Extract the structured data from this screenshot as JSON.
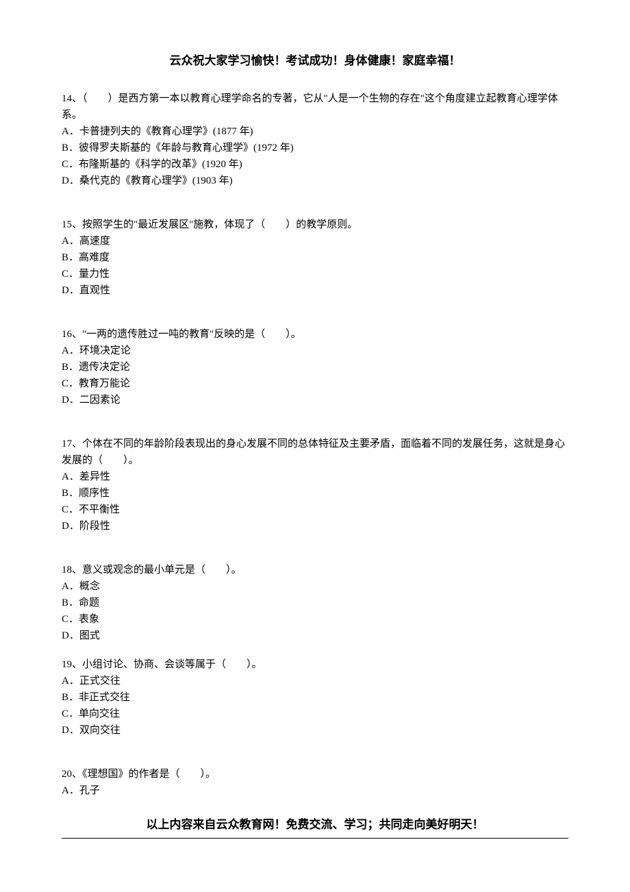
{
  "header": "云众祝大家学习愉快！考试成功！身体健康！家庭幸福！",
  "questions": [
    {
      "stem": "14、（　　）是西方第一本以教育心理学命名的专著，它从\"人是一个生物的存在\"这个角度建立起教育心理学体系。",
      "options": [
        "A．卡普捷列夫的《教育心理学》(1877 年)",
        "B．彼得罗夫斯基的《年龄与教育心理学》(1972 年)",
        "C．布隆斯基的《科学的改革》(1920 年)",
        "D．桑代克的《教育心理学》(1903 年)"
      ]
    },
    {
      "stem": "15、按照学生的\"最近发展区\"施教，体现了（　　）的教学原则。",
      "options": [
        "A．高速度",
        "B．高难度",
        "C．量力性",
        "D．直观性"
      ]
    },
    {
      "stem": "16、\"一两的遗传胜过一吨的教育\"反映的是（　　）。",
      "options": [
        "A．环境决定论",
        "B．遗传决定论",
        "C．教育万能论",
        "D．二因素论"
      ]
    },
    {
      "stem": "17、个体在不同的年龄阶段表现出的身心发展不同的总体特征及主要矛盾，面临着不同的发展任务，这就是身心发展的（　　）。",
      "options": [
        "A．差异性",
        "B．顺序性",
        "C．不平衡性",
        "D．阶段性"
      ]
    },
    {
      "stem": "18、意义或观念的最小单元是（　　）。",
      "options": [
        "A．概念",
        "B．命题",
        "C．表象",
        "D．图式"
      ]
    },
    {
      "stem": "19、小组讨论、协商、会谈等属于（　　）。",
      "options": [
        "A．正式交往",
        "B．非正式交往",
        "C．单向交往",
        "D．双向交往"
      ]
    },
    {
      "stem": "20、《理想国》的作者是（　　）。",
      "options": [
        "A．孔子"
      ]
    }
  ],
  "footer": "以上内容来自云众教育网！免费交流、学习；共同走向美好明天！"
}
